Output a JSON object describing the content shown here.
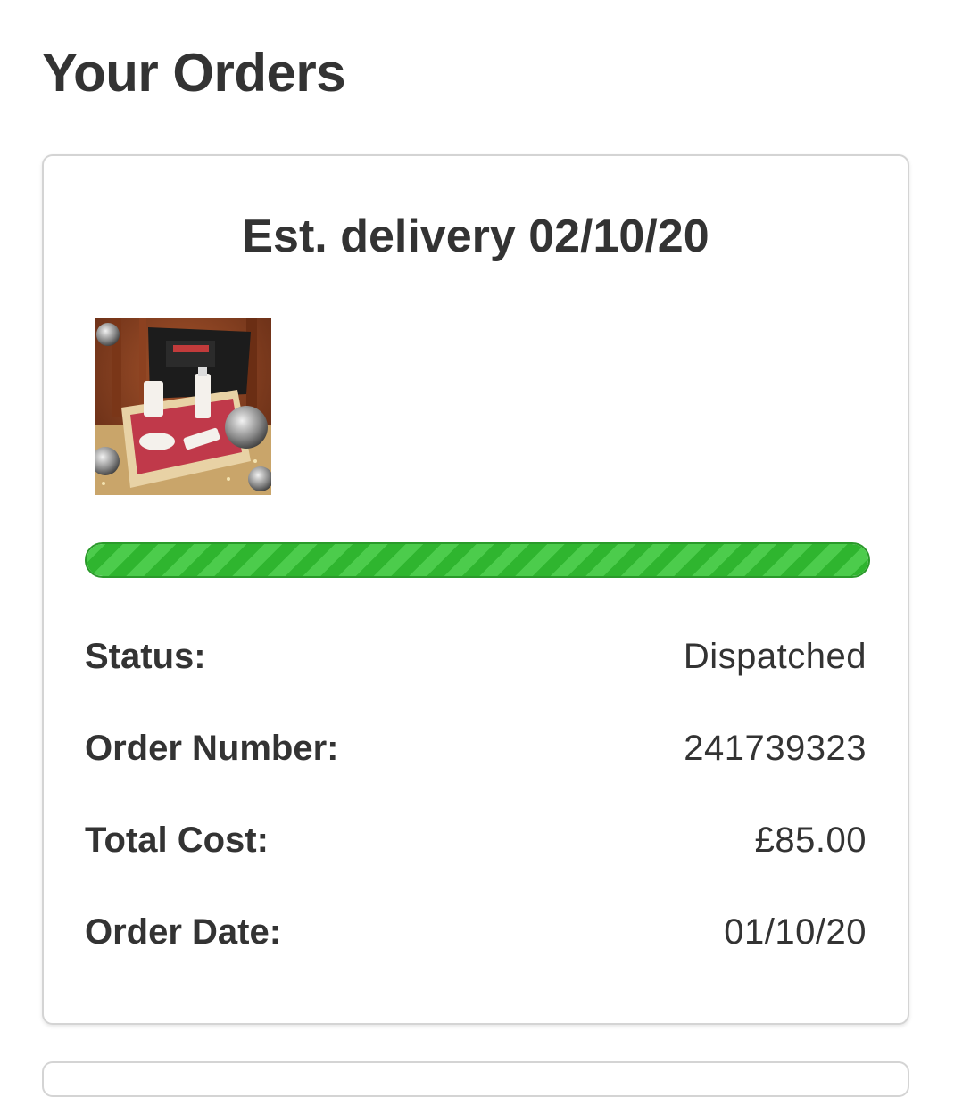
{
  "page": {
    "title": "Your Orders"
  },
  "order": {
    "delivery_heading": "Est. delivery 02/10/20",
    "progress": 1.0,
    "progress_color": "#2fb52f",
    "details": [
      {
        "label": "Status:",
        "value": "Dispatched"
      },
      {
        "label": "Order Number:",
        "value": "241739323"
      },
      {
        "label": "Total Cost:",
        "value": "£85.00"
      },
      {
        "label": "Order Date:",
        "value": "01/10/20"
      }
    ]
  }
}
